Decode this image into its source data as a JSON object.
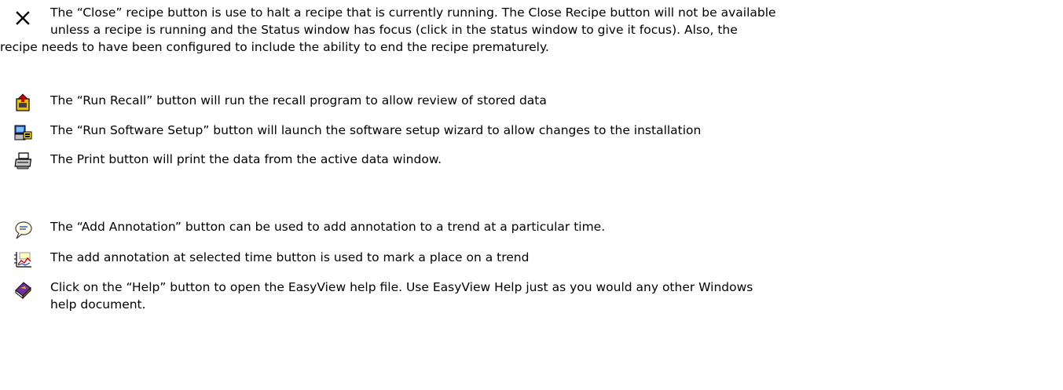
{
  "entries": [
    {
      "icon": "close-x-icon",
      "lines": [
        "The “Close” recipe button is use to halt a recipe that is currently running. The Close Recipe button will not be available",
        "unless a recipe is running and the Status window has focus (click in the status window to give it focus). Also, the",
        "recipe needs to have been configured to include the ability to end the recipe prematurely."
      ]
    },
    {
      "icon": "run-recall-icon",
      "text": "The “Run Recall” button will run the recall program to allow review of stored data"
    },
    {
      "icon": "software-setup-icon",
      "text": "The “Run Software Setup” button will launch the software setup wizard to allow changes to the installation"
    },
    {
      "icon": "printer-icon",
      "text": " The Print button will print the data from the active data window."
    },
    {
      "icon": "speech-bubble-icon",
      "text": "The “Add Annotation” button can be used to add annotation to a trend at a particular time."
    },
    {
      "icon": "trend-annotation-icon",
      "text": "The add annotation at selected time button is used to mark a place on a trend"
    },
    {
      "icon": "help-book-icon",
      "lines": [
        "Click on the “Help” button to open the EasyView help file. Use EasyView Help just as you would any other Windows",
        "help document."
      ]
    }
  ]
}
